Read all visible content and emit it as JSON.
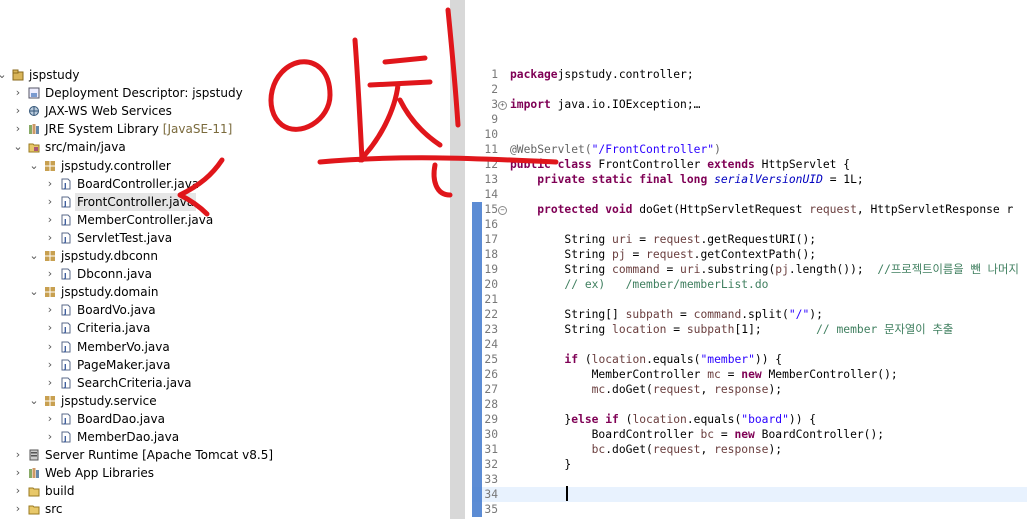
{
  "project_explorer": {
    "items": [
      {
        "label": "jspstudy",
        "decor": "",
        "depth": 0,
        "expanded": true,
        "icon": "project-icon"
      },
      {
        "label": "Deployment Descriptor: jspstudy",
        "decor": "",
        "depth": 1,
        "expanded": false,
        "icon": "deployment-descriptor-icon"
      },
      {
        "label": "JAX-WS Web Services",
        "decor": "",
        "depth": 1,
        "expanded": false,
        "icon": "web-services-icon"
      },
      {
        "label": "JRE System Library",
        "decor": "[JavaSE-11]",
        "depth": 1,
        "expanded": false,
        "icon": "library-icon"
      },
      {
        "label": "src/main/java",
        "decor": "",
        "depth": 1,
        "expanded": true,
        "icon": "source-folder-icon"
      },
      {
        "label": "jspstudy.controller",
        "decor": "",
        "depth": 2,
        "expanded": true,
        "icon": "package-icon"
      },
      {
        "label": "BoardController.java",
        "decor": "",
        "depth": 3,
        "expanded": false,
        "icon": "java-file-icon"
      },
      {
        "label": "FrontController.java",
        "decor": "",
        "depth": 3,
        "expanded": false,
        "icon": "java-file-icon",
        "selected": true
      },
      {
        "label": "MemberController.java",
        "decor": "",
        "depth": 3,
        "expanded": false,
        "icon": "java-file-icon"
      },
      {
        "label": "ServletTest.java",
        "decor": "",
        "depth": 3,
        "expanded": false,
        "icon": "java-file-icon"
      },
      {
        "label": "jspstudy.dbconn",
        "decor": "",
        "depth": 2,
        "expanded": true,
        "icon": "package-icon"
      },
      {
        "label": "Dbconn.java",
        "decor": "",
        "depth": 3,
        "expanded": false,
        "icon": "java-file-icon"
      },
      {
        "label": "jspstudy.domain",
        "decor": "",
        "depth": 2,
        "expanded": true,
        "icon": "package-icon"
      },
      {
        "label": "BoardVo.java",
        "decor": "",
        "depth": 3,
        "expanded": false,
        "icon": "java-file-icon"
      },
      {
        "label": "Criteria.java",
        "decor": "",
        "depth": 3,
        "expanded": false,
        "icon": "java-file-icon"
      },
      {
        "label": "MemberVo.java",
        "decor": "",
        "depth": 3,
        "expanded": false,
        "icon": "java-file-icon"
      },
      {
        "label": "PageMaker.java",
        "decor": "",
        "depth": 3,
        "expanded": false,
        "icon": "java-file-icon"
      },
      {
        "label": "SearchCriteria.java",
        "decor": "",
        "depth": 3,
        "expanded": false,
        "icon": "java-file-icon"
      },
      {
        "label": "jspstudy.service",
        "decor": "",
        "depth": 2,
        "expanded": true,
        "icon": "package-icon"
      },
      {
        "label": "BoardDao.java",
        "decor": "",
        "depth": 3,
        "expanded": false,
        "icon": "java-file-icon"
      },
      {
        "label": "MemberDao.java",
        "decor": "",
        "depth": 3,
        "expanded": false,
        "icon": "java-file-icon"
      },
      {
        "label": "Server Runtime [Apache Tomcat v8.5]",
        "decor": "",
        "depth": 1,
        "expanded": false,
        "icon": "server-runtime-icon"
      },
      {
        "label": "Web App Libraries",
        "decor": "",
        "depth": 1,
        "expanded": false,
        "icon": "library-icon"
      },
      {
        "label": "build",
        "decor": "",
        "depth": 1,
        "expanded": false,
        "icon": "folder-icon"
      },
      {
        "label": "src",
        "decor": "",
        "depth": 1,
        "expanded": false,
        "icon": "folder-icon"
      }
    ]
  },
  "editor": {
    "lines": [
      {
        "n": "1",
        "tokens": [
          [
            "kw",
            "package"
          ],
          [
            "",
            "jspstudy.controller;"
          ]
        ]
      },
      {
        "n": "2",
        "tokens": []
      },
      {
        "n": "3",
        "fold": "+",
        "tokens": [
          [
            "kw",
            "import"
          ],
          [
            "",
            " java.io.IOException;"
          ],
          [
            "",
            "…"
          ]
        ]
      },
      {
        "n": "9",
        "tokens": []
      },
      {
        "n": "10",
        "tokens": []
      },
      {
        "n": "11",
        "tokens": [
          [
            "ann",
            "@WebServlet("
          ],
          [
            "str",
            "\"/FrontController\""
          ],
          [
            "ann",
            ")"
          ]
        ]
      },
      {
        "n": "12",
        "tokens": [
          [
            "kw",
            "public class"
          ],
          [
            "",
            " FrontController "
          ],
          [
            "kw",
            "extends"
          ],
          [
            "",
            " HttpServlet {"
          ]
        ]
      },
      {
        "n": "13",
        "tokens": [
          [
            "",
            "    "
          ],
          [
            "kw",
            "private static final long"
          ],
          [
            "fld",
            " serialVersionUID"
          ],
          [
            "",
            " = 1L;"
          ]
        ]
      },
      {
        "n": "14",
        "tokens": []
      },
      {
        "n": "15",
        "fold": "-",
        "marker": true,
        "tokens": [
          [
            "",
            "    "
          ],
          [
            "kw",
            "protected void"
          ],
          [
            "",
            " doGet(HttpServletRequest "
          ],
          [
            "var",
            "request"
          ],
          [
            "",
            ", HttpServletResponse r"
          ]
        ]
      },
      {
        "n": "16",
        "marker": true,
        "tokens": []
      },
      {
        "n": "17",
        "marker": true,
        "tokens": [
          [
            "",
            "        String "
          ],
          [
            "var",
            "uri"
          ],
          [
            "",
            " = "
          ],
          [
            "var",
            "request"
          ],
          [
            "",
            ".getRequestURI();"
          ]
        ]
      },
      {
        "n": "18",
        "marker": true,
        "tokens": [
          [
            "",
            "        String "
          ],
          [
            "var",
            "pj"
          ],
          [
            "",
            " = "
          ],
          [
            "var",
            "request"
          ],
          [
            "",
            ".getContextPath();"
          ]
        ]
      },
      {
        "n": "19",
        "marker": true,
        "tokens": [
          [
            "",
            "        String "
          ],
          [
            "var",
            "command"
          ],
          [
            "",
            " = "
          ],
          [
            "var",
            "uri"
          ],
          [
            "",
            ".substring("
          ],
          [
            "var",
            "pj"
          ],
          [
            "",
            ".length());  "
          ],
          [
            "cmt",
            "//프로젝트이름을 뺀 나머지"
          ]
        ]
      },
      {
        "n": "20",
        "marker": true,
        "tokens": [
          [
            "cmt",
            "        // ex)   /member/memberList.do"
          ]
        ]
      },
      {
        "n": "21",
        "marker": true,
        "tokens": []
      },
      {
        "n": "22",
        "marker": true,
        "tokens": [
          [
            "",
            "        String[] "
          ],
          [
            "var",
            "subpath"
          ],
          [
            "",
            " = "
          ],
          [
            "var",
            "command"
          ],
          [
            "",
            ".split("
          ],
          [
            "str",
            "\"/\""
          ],
          [
            "",
            ");"
          ]
        ]
      },
      {
        "n": "23",
        "marker": true,
        "tokens": [
          [
            "",
            "        String "
          ],
          [
            "var",
            "location"
          ],
          [
            "",
            " = "
          ],
          [
            "var",
            "subpath"
          ],
          [
            "",
            "[1];        "
          ],
          [
            "cmt",
            "// member 문자열이 추출"
          ]
        ]
      },
      {
        "n": "24",
        "marker": true,
        "tokens": []
      },
      {
        "n": "25",
        "marker": true,
        "tokens": [
          [
            "",
            "        "
          ],
          [
            "kw",
            "if"
          ],
          [
            "",
            " ("
          ],
          [
            "var",
            "location"
          ],
          [
            "",
            ".equals("
          ],
          [
            "str",
            "\"member\""
          ],
          [
            "",
            ")) {"
          ]
        ]
      },
      {
        "n": "26",
        "marker": true,
        "tokens": [
          [
            "",
            "            MemberController "
          ],
          [
            "var",
            "mc"
          ],
          [
            "",
            " = "
          ],
          [
            "kw",
            "new"
          ],
          [
            "",
            " MemberController();"
          ]
        ]
      },
      {
        "n": "27",
        "marker": true,
        "tokens": [
          [
            "",
            "            "
          ],
          [
            "var",
            "mc"
          ],
          [
            "",
            ".doGet("
          ],
          [
            "var",
            "request"
          ],
          [
            "",
            ", "
          ],
          [
            "var",
            "response"
          ],
          [
            "",
            ");"
          ]
        ]
      },
      {
        "n": "28",
        "marker": true,
        "tokens": []
      },
      {
        "n": "29",
        "marker": true,
        "tokens": [
          [
            "",
            "        }"
          ],
          [
            "kw",
            "else if"
          ],
          [
            "",
            " ("
          ],
          [
            "var",
            "location"
          ],
          [
            "",
            ".equals("
          ],
          [
            "str",
            "\"board\""
          ],
          [
            "",
            ")) {"
          ]
        ]
      },
      {
        "n": "30",
        "marker": true,
        "tokens": [
          [
            "",
            "            BoardController "
          ],
          [
            "var",
            "bc"
          ],
          [
            "",
            " = "
          ],
          [
            "kw",
            "new"
          ],
          [
            "",
            " BoardController();"
          ]
        ]
      },
      {
        "n": "31",
        "marker": true,
        "tokens": [
          [
            "",
            "            "
          ],
          [
            "var",
            "bc"
          ],
          [
            "",
            ".doGet("
          ],
          [
            "var",
            "request"
          ],
          [
            "",
            ", "
          ],
          [
            "var",
            "response"
          ],
          [
            "",
            ");"
          ]
        ]
      },
      {
        "n": "32",
        "marker": true,
        "tokens": [
          [
            "",
            "        }"
          ]
        ]
      },
      {
        "n": "33",
        "marker": true,
        "tokens": []
      },
      {
        "n": "34",
        "marker": true,
        "current": true,
        "tokens": []
      },
      {
        "n": "35",
        "marker": true,
        "tokens": []
      }
    ]
  },
  "annotation": {
    "handwritten_text": "일친",
    "color": "#e0161b"
  }
}
